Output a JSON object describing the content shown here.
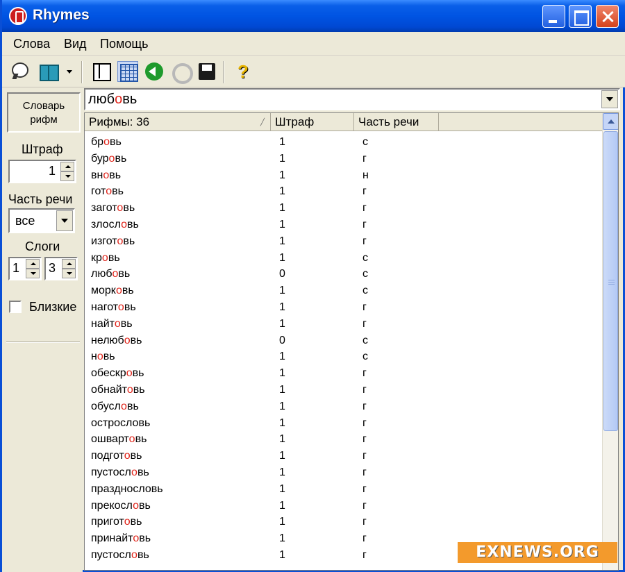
{
  "window": {
    "title": "Rhymes"
  },
  "menu": {
    "items": [
      "Слова",
      "Вид",
      "Помощь"
    ]
  },
  "toolbar": {
    "icons": [
      "balloon-icon",
      "book-icon",
      "dropdown-caret",
      "panel-icon",
      "grid-icon",
      "back-icon",
      "refresh-icon",
      "save-icon",
      "help-icon"
    ],
    "help_glyph": "?"
  },
  "left_panel": {
    "dictionary_button": "Словарь\nрифм",
    "penalty_label": "Штраф",
    "penalty_value": "1",
    "pos_label": "Часть речи",
    "pos_value": "все",
    "syllables_label": "Слоги",
    "syllables_min": "1",
    "syllables_max": "3",
    "close_label": "Близкие",
    "close_checked": false
  },
  "search": {
    "pre": "люб",
    "stress": "о",
    "post": "вь"
  },
  "list": {
    "headers": {
      "rhymes": "Рифмы: 36",
      "penalty": "Штраф",
      "pos": "Часть речи"
    },
    "rows": [
      {
        "pre": "бр",
        "stress": "о",
        "post": "вь",
        "penalty": "1",
        "pos": "с"
      },
      {
        "pre": "бур",
        "stress": "о",
        "post": "вь",
        "penalty": "1",
        "pos": "г"
      },
      {
        "pre": "вн",
        "stress": "о",
        "post": "вь",
        "penalty": "1",
        "pos": "н"
      },
      {
        "pre": "гот",
        "stress": "о",
        "post": "вь",
        "penalty": "1",
        "pos": "г"
      },
      {
        "pre": "загот",
        "stress": "о",
        "post": "вь",
        "penalty": "1",
        "pos": "г"
      },
      {
        "pre": "злосл",
        "stress": "о",
        "post": "вь",
        "penalty": "1",
        "pos": "г"
      },
      {
        "pre": "изгот",
        "stress": "о",
        "post": "вь",
        "penalty": "1",
        "pos": "г"
      },
      {
        "pre": "кр",
        "stress": "о",
        "post": "вь",
        "penalty": "1",
        "pos": "с"
      },
      {
        "pre": "люб",
        "stress": "о",
        "post": "вь",
        "penalty": "0",
        "pos": "с"
      },
      {
        "pre": "морк",
        "stress": "о",
        "post": "вь",
        "penalty": "1",
        "pos": "с"
      },
      {
        "pre": "нагот",
        "stress": "о",
        "post": "вь",
        "penalty": "1",
        "pos": "г"
      },
      {
        "pre": "найт",
        "stress": "о",
        "post": "вь",
        "penalty": "1",
        "pos": "г"
      },
      {
        "pre": "нелюб",
        "stress": "о",
        "post": "вь",
        "penalty": "0",
        "pos": "с"
      },
      {
        "pre": "н",
        "stress": "о",
        "post": "вь",
        "penalty": "1",
        "pos": "с"
      },
      {
        "pre": "обескр",
        "stress": "о",
        "post": "вь",
        "penalty": "1",
        "pos": "г"
      },
      {
        "pre": "обнайт",
        "stress": "о",
        "post": "вь",
        "penalty": "1",
        "pos": "г"
      },
      {
        "pre": "обусл",
        "stress": "о",
        "post": "вь",
        "penalty": "1",
        "pos": "г"
      },
      {
        "pre": "острословь",
        "stress": "",
        "post": "",
        "penalty": "1",
        "pos": "г"
      },
      {
        "pre": "ошварт",
        "stress": "о",
        "post": "вь",
        "penalty": "1",
        "pos": "г"
      },
      {
        "pre": "подгот",
        "stress": "о",
        "post": "вь",
        "penalty": "1",
        "pos": "г"
      },
      {
        "pre": "пустосл",
        "stress": "о",
        "post": "вь",
        "penalty": "1",
        "pos": "г"
      },
      {
        "pre": "празднословь",
        "stress": "",
        "post": "",
        "penalty": "1",
        "pos": "г"
      },
      {
        "pre": "прекосл",
        "stress": "о",
        "post": "вь",
        "penalty": "1",
        "pos": "г"
      },
      {
        "pre": "пригот",
        "stress": "о",
        "post": "вь",
        "penalty": "1",
        "pos": "г"
      },
      {
        "pre": "принайт",
        "stress": "о",
        "post": "вь",
        "penalty": "1",
        "pos": "г"
      },
      {
        "pre": "пустосл",
        "stress": "о",
        "post": "вь",
        "penalty": "1",
        "pos": "г"
      }
    ]
  },
  "watermark": "EXNEWS.ORG",
  "colors": {
    "stress": "#e0241a",
    "titlebar": "#0054e3",
    "watermark": "#f39a2c"
  }
}
